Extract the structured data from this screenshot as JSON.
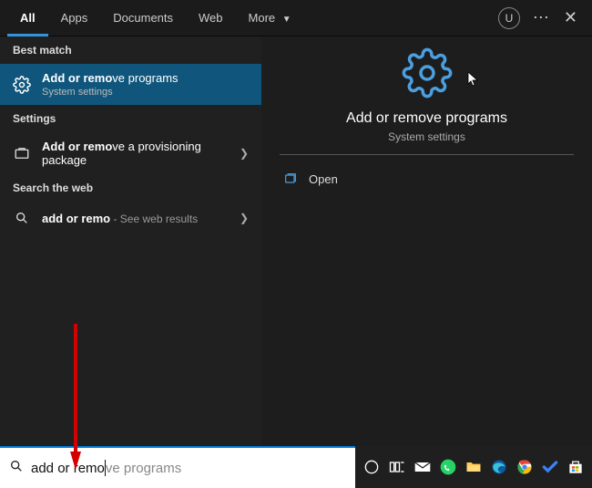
{
  "tabs": {
    "all": "All",
    "apps": "Apps",
    "documents": "Documents",
    "web": "Web",
    "more": "More"
  },
  "avatar_initial": "U",
  "sections": {
    "best_match": "Best match",
    "settings": "Settings",
    "search_web": "Search the web"
  },
  "best_match": {
    "title_bold": "Add or remo",
    "title_rest": "ve programs",
    "sub": "System settings"
  },
  "settings_item": {
    "title_bold": "Add or remo",
    "title_rest": "ve a provisioning package"
  },
  "web_item": {
    "title_bold": "add or remo",
    "hint": " - See web results"
  },
  "hero": {
    "title": "Add or remove programs",
    "sub": "System settings"
  },
  "action_open": "Open",
  "search": {
    "typed": "add or remo",
    "ghost": "ve programs"
  }
}
